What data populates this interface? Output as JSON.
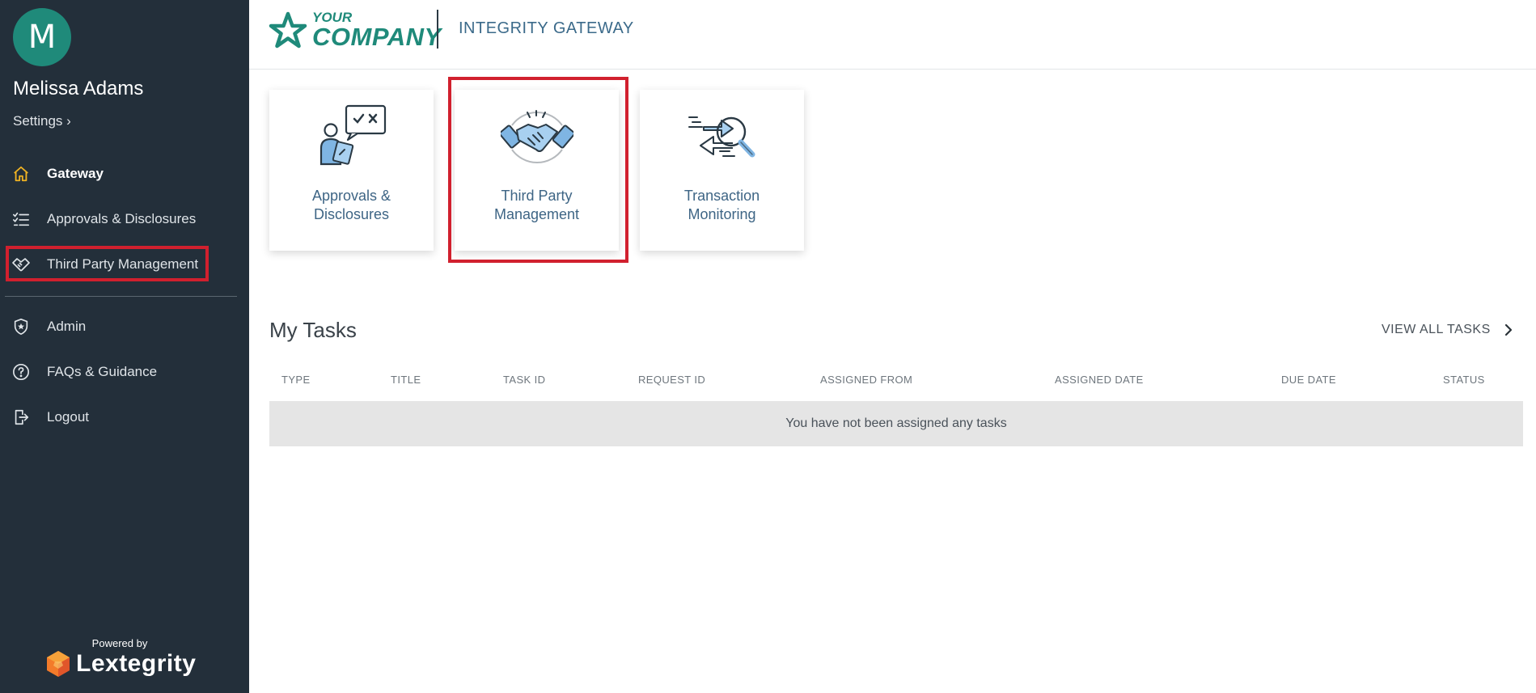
{
  "sidebar": {
    "avatar_initial": "M",
    "user_name": "Melissa Adams",
    "settings_label": "Settings ›",
    "items": [
      {
        "label": "Gateway",
        "icon": "home-icon",
        "active": true
      },
      {
        "label": "Approvals & Disclosures",
        "icon": "checklist-icon"
      },
      {
        "label": "Third Party Management",
        "icon": "handshake-icon"
      },
      {
        "label": "Admin",
        "icon": "shield-star-icon"
      },
      {
        "label": "FAQs & Guidance",
        "icon": "question-circle-icon"
      },
      {
        "label": "Logout",
        "icon": "logout-icon"
      }
    ],
    "powered_by": "Powered by",
    "brand": "Lextegrity"
  },
  "header": {
    "logo_line1": "YOUR",
    "logo_line2": "COMPANY",
    "title": "INTEGRITY GATEWAY"
  },
  "tiles": [
    {
      "line1": "Approvals &",
      "line2": "Disclosures",
      "icon": "approvals-icon"
    },
    {
      "line1": "Third Party",
      "line2": "Management",
      "icon": "handshake-icon"
    },
    {
      "line1": "Transaction",
      "line2": "Monitoring",
      "icon": "magnifier-arrows-icon"
    }
  ],
  "tasks": {
    "title": "My Tasks",
    "view_all": "VIEW ALL TASKS",
    "columns": [
      "TYPE",
      "TITLE",
      "TASK ID",
      "REQUEST ID",
      "ASSIGNED FROM",
      "ASSIGNED DATE",
      "DUE DATE",
      "STATUS"
    ],
    "empty_message": "You have not been assigned any tasks"
  },
  "colors": {
    "sidebar_bg": "#232f3a",
    "accent_teal": "#1f8a7a",
    "highlight_red": "#d1202e",
    "active_icon": "#f0b323",
    "tile_text": "#3e6585"
  }
}
